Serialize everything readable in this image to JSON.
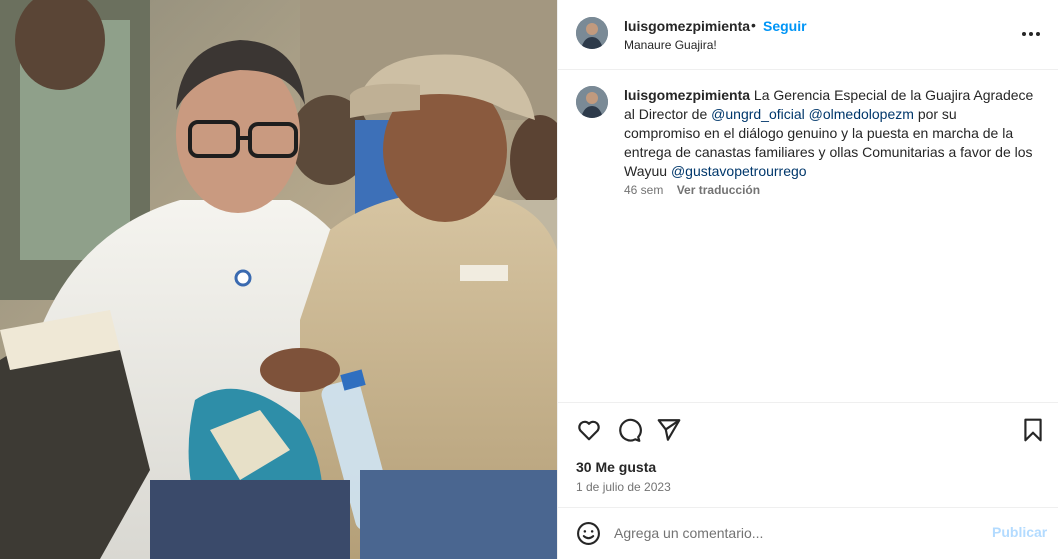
{
  "post": {
    "photo_icon": "photo-of-two-men-at-community-meeting"
  },
  "header": {
    "username": "luisgomezpimienta",
    "separator": "•",
    "follow_label": "Seguir",
    "location": "Manaure Guajira!",
    "more_icon": "more-horizontal-icon"
  },
  "caption": {
    "username": "luisgomezpimienta",
    "text_1": "La Gerencia Especial de la Guajira Agradece al Director de",
    "mention_1": "@ungrd_oficial",
    "mention_2": "@olmedolopezm",
    "text_2": "por su compromiso en el diálogo genuino y la puesta en marcha de la entrega de canastas familiares y ollas Comunitarias a favor de los Wayuu",
    "mention_3": "@gustavopetrourrego",
    "time_ago": "46 sem",
    "translate_label": "Ver traducción"
  },
  "actions": {
    "like_icon": "heart-icon",
    "comment_icon": "comment-icon",
    "share_icon": "send-icon",
    "save_icon": "bookmark-icon",
    "likes": "30 Me gusta",
    "date": "1 de julio de 2023"
  },
  "comment": {
    "emoji_icon": "smiley-icon",
    "placeholder": "Agrega un comentario...",
    "publish_label": "Publicar"
  },
  "colors": {
    "accent": "#0095f6",
    "mention": "#00376b",
    "muted": "#737373",
    "publish_disabled": "#b3dbff"
  }
}
